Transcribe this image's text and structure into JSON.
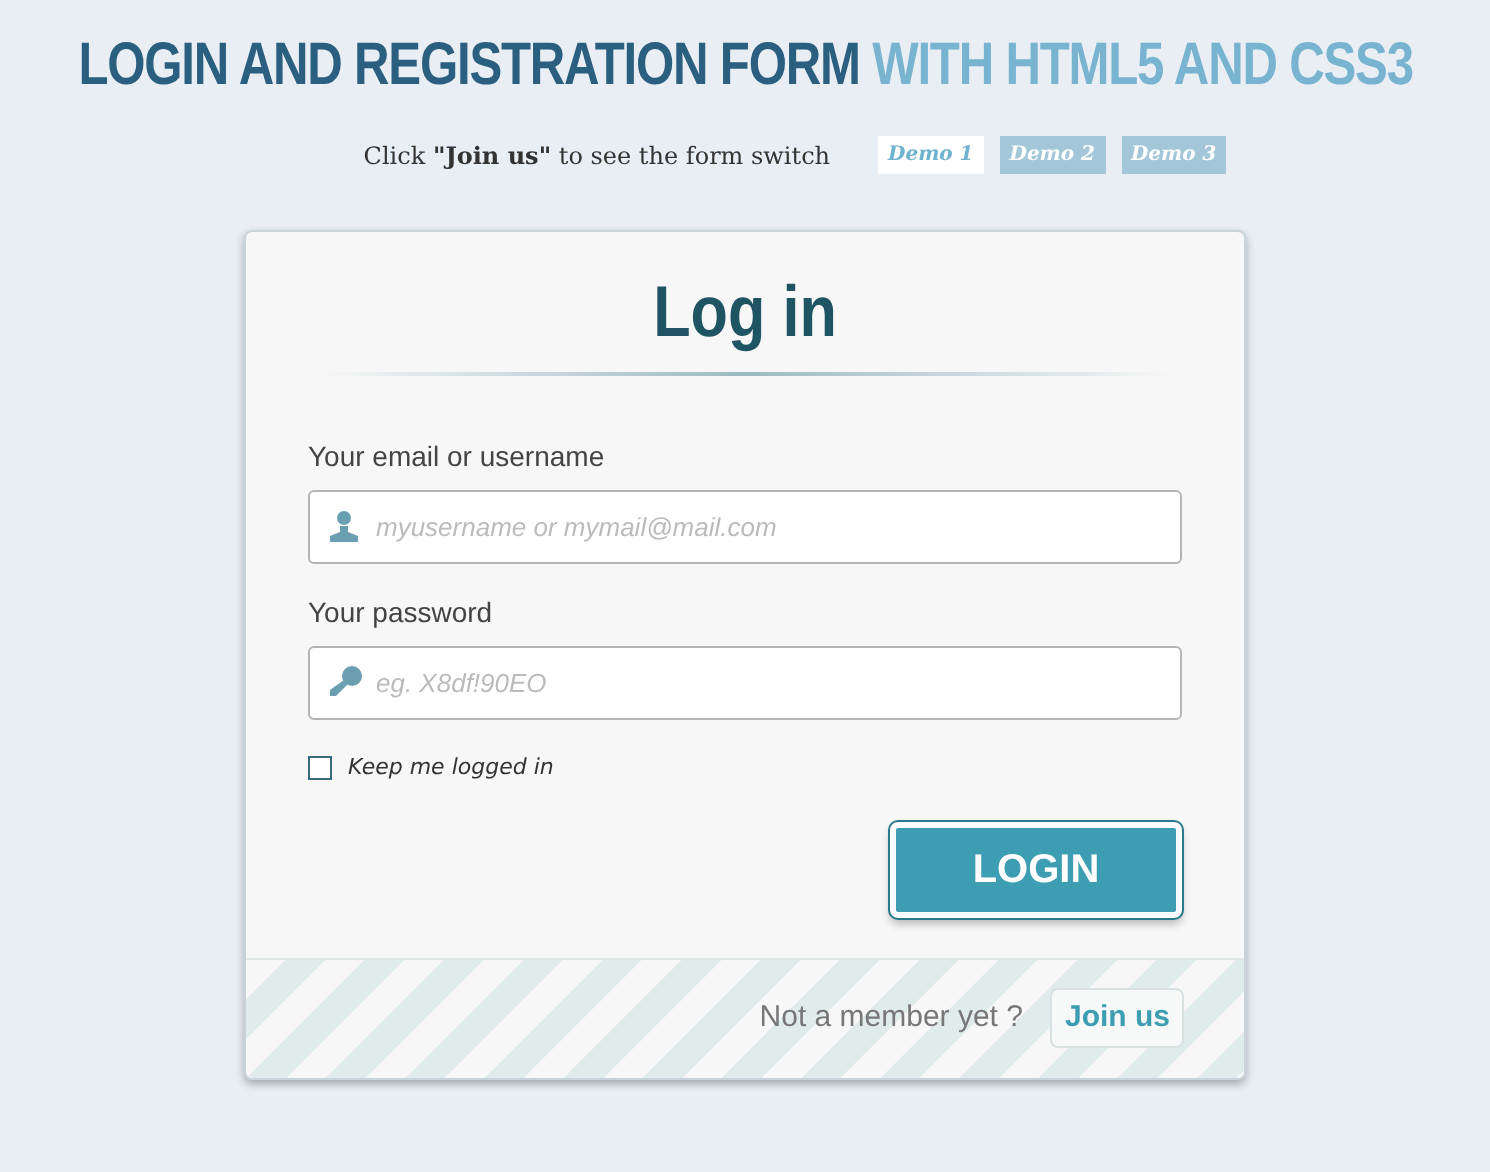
{
  "header": {
    "title": "LOGIN AND REGISTRATION FORM",
    "title_accent": "WITH HTML5 AND CSS3"
  },
  "hint": "Click **\"Join us\"** to see the form switch",
  "demos": [
    {
      "label": "Demo 1",
      "selected": true
    },
    {
      "label": "Demo 2",
      "selected": false
    },
    {
      "label": "Demo 3",
      "selected": false
    }
  ],
  "form": {
    "title": "Log in",
    "fields": [
      {
        "label": "Your email or username",
        "placeholder": "myusername or mymail@mail.com",
        "kind": "user"
      },
      {
        "label": "Your password",
        "placeholder": "eg. X8df!90EO",
        "kind": "password"
      }
    ],
    "remember": {
      "label": "Keep me logged in",
      "checked": false
    },
    "submit": "LOGIN"
  },
  "footer": {
    "text": "Not a member yet ?",
    "link": "Join us"
  }
}
